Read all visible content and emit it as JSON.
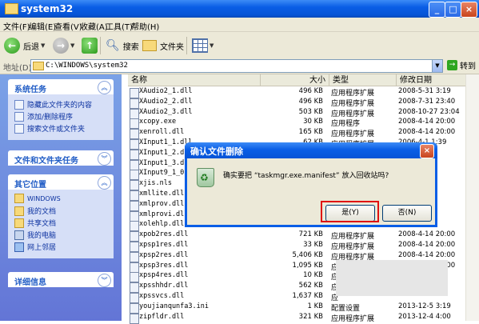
{
  "window": {
    "title": "system32"
  },
  "menu": [
    "文件(F)",
    "编辑(E)",
    "查看(V)",
    "收藏(A)",
    "工具(T)",
    "帮助(H)"
  ],
  "toolbar": {
    "back": "后退",
    "search": "搜索",
    "folders": "文件夹"
  },
  "address": {
    "label": "地址(D)",
    "path": "C:\\WINDOWS\\system32",
    "go": "转到"
  },
  "left_pane": {
    "system_tasks": {
      "title": "系统任务",
      "items": [
        "隐藏此文件夹的内容",
        "添加/删除程序",
        "搜索文件或文件夹"
      ]
    },
    "file_folder_tasks": {
      "title": "文件和文件夹任务"
    },
    "other_places": {
      "title": "其它位置",
      "items": [
        "WINDOWS",
        "我的文档",
        "共享文档",
        "我的电脑",
        "网上邻居"
      ]
    },
    "details": {
      "title": "详细信息"
    }
  },
  "columns": {
    "name": "名称",
    "size": "大小",
    "type": "类型",
    "modified": "修改日期"
  },
  "files": [
    {
      "name": "XAudio2_1.dll",
      "size": "496 KB",
      "type": "应用程序扩展",
      "date": "2008-5-31 3:19"
    },
    {
      "name": "XAudio2_2.dll",
      "size": "496 KB",
      "type": "应用程序扩展",
      "date": "2008-7-31 23:40"
    },
    {
      "name": "XAudio2_3.dll",
      "size": "503 KB",
      "type": "应用程序扩展",
      "date": "2008-10-27 23:04"
    },
    {
      "name": "xcopy.exe",
      "size": "30 KB",
      "type": "应用程序",
      "date": "2008-4-14 20:00"
    },
    {
      "name": "xenroll.dll",
      "size": "165 KB",
      "type": "应用程序扩展",
      "date": "2008-4-14 20:00"
    },
    {
      "name": "XInput1_1.dll",
      "size": "62 KB",
      "type": "应用程序扩展",
      "date": "2006-4-1 1:39"
    },
    {
      "name": "XInput1_2.dll",
      "size": "",
      "type": "",
      "date": "22:30"
    },
    {
      "name": "XInput1_3.dll",
      "size": "",
      "type": "",
      "date": "3:28"
    },
    {
      "name": "XInput9_1_0.",
      "size": "",
      "type": "",
      "date": ":57"
    },
    {
      "name": "xjis.nls",
      "size": "",
      "type": "",
      "date": ":00"
    },
    {
      "name": "xmllite.dll",
      "size": "",
      "type": "",
      "date": "3:21"
    },
    {
      "name": "xmlprov.dll",
      "size": "",
      "type": "",
      "date": ":00"
    },
    {
      "name": "xmlprovi.dll",
      "size": "",
      "type": "",
      "date": ":00"
    },
    {
      "name": "xolehlp.dll",
      "size": "",
      "type": "",
      "date": ":00"
    },
    {
      "name": "xpob2res.dll",
      "size": "721 KB",
      "type": "应用程序扩展",
      "date": "2008-4-14 20:00"
    },
    {
      "name": "xpsp1res.dll",
      "size": "33 KB",
      "type": "应用程序扩展",
      "date": "2008-4-14 20:00"
    },
    {
      "name": "xpsp2res.dll",
      "size": "5,406 KB",
      "type": "应用程序扩展",
      "date": "2008-4-14 20:00"
    },
    {
      "name": "xpsp3res.dll",
      "size": "1,095 KB",
      "type": "应用程序扩展",
      "date": "2008-4-14 20:00"
    },
    {
      "name": "xpsp4res.dll",
      "size": "10 KB",
      "type": "应",
      "date": ""
    },
    {
      "name": "xpsshhdr.dll",
      "size": "562 KB",
      "type": "应",
      "date": ""
    },
    {
      "name": "xpssvcs.dll",
      "size": "1,637 KB",
      "type": "应",
      "date": ""
    },
    {
      "name": "youjianqunfa3.ini",
      "size": "1 KB",
      "type": "配置设置",
      "date": "2013-12-5 3:19"
    },
    {
      "name": "zipfldr.dll",
      "size": "321 KB",
      "type": "应用程序扩展",
      "date": "2013-12-4 4:00"
    }
  ],
  "dialog": {
    "title": "确认文件删除",
    "message": "确实要把 “taskmgr.exe.manifest” 放入回收站吗?",
    "yes": "是(Y)",
    "no": "否(N)"
  },
  "colors": {
    "titlebar": "#0a5ee6",
    "highlight": "#e01010",
    "task_link": "#0c32a0"
  }
}
